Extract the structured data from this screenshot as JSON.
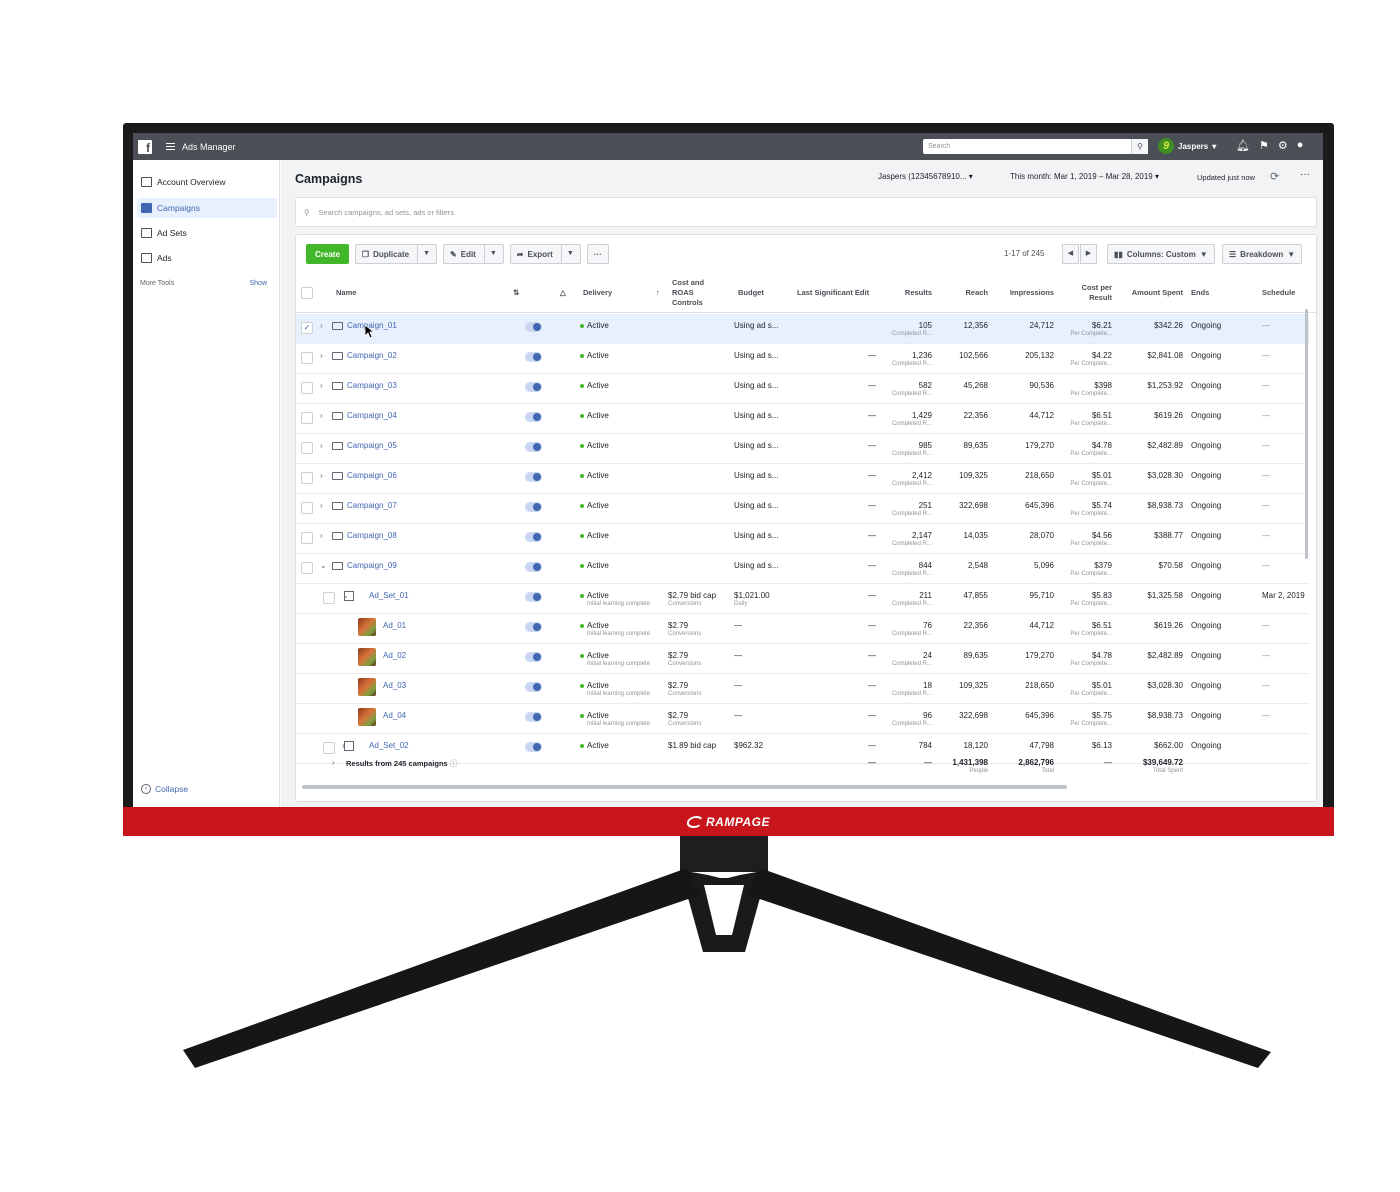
{
  "brand": {
    "name": "RAMPAGE"
  },
  "topbar": {
    "app_title": "Ads Manager",
    "search_placeholder": "Search",
    "user_name": "Jaspers",
    "avatar_letter": "9"
  },
  "sidebar": {
    "items": [
      {
        "label": "Account Overview",
        "icon": "account-overview-icon",
        "active": false
      },
      {
        "label": "Campaigns",
        "icon": "folder-icon",
        "active": true
      },
      {
        "label": "Ad Sets",
        "icon": "grid-icon",
        "active": false
      },
      {
        "label": "Ads",
        "icon": "ad-icon",
        "active": false
      }
    ],
    "more_tools": "More Tools",
    "show": "Show",
    "collapse": "Collapse"
  },
  "header": {
    "title": "Campaigns",
    "account": "Jaspers (12345678910...",
    "date_range": "This month: Mar 1, 2019 – Mar 28, 2019",
    "updated": "Updated just now"
  },
  "filter": {
    "placeholder": "Search campaigns, ad sets, ads or filters"
  },
  "toolbar": {
    "create": "Create",
    "duplicate": "Duplicate",
    "edit": "Edit",
    "export": "Export",
    "more": "···",
    "pager": "1-17 of 245",
    "columns": "Columns: Custom",
    "breakdown": "Breakdown"
  },
  "columns": {
    "name": "Name",
    "delivery": "Delivery",
    "cost_roas": [
      "Cost and",
      "ROAS",
      "Controls"
    ],
    "budget": "Budget",
    "last_edit": "Last Significant Edit",
    "results": "Results",
    "reach": "Reach",
    "impressions": "Impressions",
    "cost_per_result": [
      "Cost per",
      "Result"
    ],
    "amount_spent": "Amount Spent",
    "ends": "Ends",
    "schedule": "Schedule"
  },
  "rows": [
    {
      "type": "campaign",
      "name": "Campaign_01",
      "delivery": "Active",
      "delivery_sub": "",
      "cost": "",
      "cost_sub": "",
      "budget": "Using ad s...",
      "budget_sub": "",
      "last_edit": "",
      "results": "105",
      "results_sub": "Completed R...",
      "reach": "12,356",
      "impressions": "24,712",
      "cpr": "$6.21",
      "cpr_sub": "Per Complete...",
      "spent": "$342.26",
      "ends": "Ongoing",
      "schedule": "—",
      "selected": true,
      "expanded": false
    },
    {
      "type": "campaign",
      "name": "Campaign_02",
      "delivery": "Active",
      "delivery_sub": "",
      "cost": "",
      "cost_sub": "",
      "budget": "Using ad s...",
      "budget_sub": "",
      "last_edit": "—",
      "results": "1,236",
      "results_sub": "Completed R...",
      "reach": "102,566",
      "impressions": "205,132",
      "cpr": "$4.22",
      "cpr_sub": "Per Complete...",
      "spent": "$2,841.08",
      "ends": "Ongoing",
      "schedule": "—",
      "selected": false,
      "expanded": false
    },
    {
      "type": "campaign",
      "name": "Campaign_03",
      "delivery": "Active",
      "delivery_sub": "",
      "cost": "",
      "cost_sub": "",
      "budget": "Using ad s...",
      "budget_sub": "",
      "last_edit": "—",
      "results": "582",
      "results_sub": "Completed R...",
      "reach": "45,268",
      "impressions": "90,536",
      "cpr": "$398",
      "cpr_sub": "Per Complete...",
      "spent": "$1,253.92",
      "ends": "Ongoing",
      "schedule": "—",
      "selected": false,
      "expanded": false
    },
    {
      "type": "campaign",
      "name": "Campaign_04",
      "delivery": "Active",
      "delivery_sub": "",
      "cost": "",
      "cost_sub": "",
      "budget": "Using ad s...",
      "budget_sub": "",
      "last_edit": "—",
      "results": "1,429",
      "results_sub": "Completed R...",
      "reach": "22,356",
      "impressions": "44,712",
      "cpr": "$6.51",
      "cpr_sub": "Per Complete...",
      "spent": "$619.26",
      "ends": "Ongoing",
      "schedule": "—",
      "selected": false,
      "expanded": false
    },
    {
      "type": "campaign",
      "name": "Campaign_05",
      "delivery": "Active",
      "delivery_sub": "",
      "cost": "",
      "cost_sub": "",
      "budget": "Using ad s...",
      "budget_sub": "",
      "last_edit": "—",
      "results": "985",
      "results_sub": "Completed R...",
      "reach": "89,635",
      "impressions": "179,270",
      "cpr": "$4.78",
      "cpr_sub": "Per Complete...",
      "spent": "$2,482.89",
      "ends": "Ongoing",
      "schedule": "—",
      "selected": false,
      "expanded": false
    },
    {
      "type": "campaign",
      "name": "Campaign_06",
      "delivery": "Active",
      "delivery_sub": "",
      "cost": "",
      "cost_sub": "",
      "budget": "Using ad s...",
      "budget_sub": "",
      "last_edit": "—",
      "results": "2,412",
      "results_sub": "Completed R...",
      "reach": "109,325",
      "impressions": "218,650",
      "cpr": "$5.01",
      "cpr_sub": "Per Complete...",
      "spent": "$3,028.30",
      "ends": "Ongoing",
      "schedule": "—",
      "selected": false,
      "expanded": false
    },
    {
      "type": "campaign",
      "name": "Campaign_07",
      "delivery": "Active",
      "delivery_sub": "",
      "cost": "",
      "cost_sub": "",
      "budget": "Using ad s...",
      "budget_sub": "",
      "last_edit": "—",
      "results": "251",
      "results_sub": "Completed R...",
      "reach": "322,698",
      "impressions": "645,396",
      "cpr": "$5.74",
      "cpr_sub": "Per Complete...",
      "spent": "$8,938.73",
      "ends": "Ongoing",
      "schedule": "—",
      "selected": false,
      "expanded": false
    },
    {
      "type": "campaign",
      "name": "Campaign_08",
      "delivery": "Active",
      "delivery_sub": "",
      "cost": "",
      "cost_sub": "",
      "budget": "Using ad s...",
      "budget_sub": "",
      "last_edit": "—",
      "results": "2,147",
      "results_sub": "Completed R...",
      "reach": "14,035",
      "impressions": "28,070",
      "cpr": "$4.56",
      "cpr_sub": "Per Complete...",
      "spent": "$388.77",
      "ends": "Ongoing",
      "schedule": "—",
      "selected": false,
      "expanded": false
    },
    {
      "type": "campaign",
      "name": "Campaign_09",
      "delivery": "Active",
      "delivery_sub": "",
      "cost": "",
      "cost_sub": "",
      "budget": "Using ad s...",
      "budget_sub": "",
      "last_edit": "—",
      "results": "844",
      "results_sub": "Completed R...",
      "reach": "2,548",
      "impressions": "5,096",
      "cpr": "$379",
      "cpr_sub": "Per Complete...",
      "spent": "$70.58",
      "ends": "Ongoing",
      "schedule": "—",
      "selected": false,
      "expanded": true
    },
    {
      "type": "adset",
      "name": "Ad_Set_01",
      "delivery": "Active",
      "delivery_sub": "Initial learning complete",
      "cost": "$2.79 bid cap",
      "cost_sub": "Conversions",
      "budget": "$1,021.00",
      "budget_sub": "Daily",
      "last_edit": "—",
      "results": "211",
      "results_sub": "Completed R...",
      "reach": "47,855",
      "impressions": "95,710",
      "cpr": "$5.83",
      "cpr_sub": "Per Complete...",
      "spent": "$1,325.58",
      "ends": "Ongoing",
      "schedule": "Mar 2, 2019",
      "selected": false,
      "expanded": true
    },
    {
      "type": "ad",
      "name": "Ad_01",
      "delivery": "Active",
      "delivery_sub": "Initial learning complete",
      "cost": "$2.79",
      "cost_sub": "Conversions",
      "budget": "—",
      "budget_sub": "",
      "last_edit": "—",
      "results": "76",
      "results_sub": "Completed R...",
      "reach": "22,356",
      "impressions": "44,712",
      "cpr": "$6.51",
      "cpr_sub": "Per Complete...",
      "spent": "$619.26",
      "ends": "Ongoing",
      "schedule": "—",
      "selected": false,
      "expanded": false
    },
    {
      "type": "ad",
      "name": "Ad_02",
      "delivery": "Active",
      "delivery_sub": "Initial learning complete",
      "cost": "$2.79",
      "cost_sub": "Conversions",
      "budget": "—",
      "budget_sub": "",
      "last_edit": "—",
      "results": "24",
      "results_sub": "Completed R...",
      "reach": "89,635",
      "impressions": "179,270",
      "cpr": "$4.78",
      "cpr_sub": "Per Complete...",
      "spent": "$2,482.89",
      "ends": "Ongoing",
      "schedule": "—",
      "selected": false,
      "expanded": false
    },
    {
      "type": "ad",
      "name": "Ad_03",
      "delivery": "Active",
      "delivery_sub": "Initial learning complete",
      "cost": "$2.79",
      "cost_sub": "Conversions",
      "budget": "—",
      "budget_sub": "",
      "last_edit": "—",
      "results": "18",
      "results_sub": "Completed R...",
      "reach": "109,325",
      "impressions": "218,650",
      "cpr": "$5.01",
      "cpr_sub": "Per Complete...",
      "spent": "$3,028.30",
      "ends": "Ongoing",
      "schedule": "—",
      "selected": false,
      "expanded": false
    },
    {
      "type": "ad",
      "name": "Ad_04",
      "delivery": "Active",
      "delivery_sub": "Initial learning complete",
      "cost": "$2.79",
      "cost_sub": "Conversions",
      "budget": "—",
      "budget_sub": "",
      "last_edit": "—",
      "results": "96",
      "results_sub": "Completed R...",
      "reach": "322,698",
      "impressions": "645,396",
      "cpr": "$5.75",
      "cpr_sub": "Per Complete...",
      "spent": "$8,938.73",
      "ends": "Ongoing",
      "schedule": "—",
      "selected": false,
      "expanded": false
    },
    {
      "type": "adset",
      "name": "Ad_Set_02",
      "delivery": "Active",
      "delivery_sub": "",
      "cost": "$1.89 bid cap",
      "cost_sub": "",
      "budget": "$962.32",
      "budget_sub": "",
      "last_edit": "—",
      "results": "784",
      "results_sub": "",
      "reach": "18,120",
      "impressions": "47,798",
      "cpr": "$6.13",
      "cpr_sub": "",
      "spent": "$662.00",
      "ends": "Ongoing",
      "schedule": "",
      "selected": false,
      "expanded": false
    }
  ],
  "totals": {
    "label": "Results from 245 campaigns",
    "last_edit": "—",
    "results": "—",
    "reach": "1,431,398",
    "reach_sub": "People",
    "impressions": "2,862,796",
    "impressions_sub": "Total",
    "cpr": "—",
    "spent": "$39,649.72",
    "spent_sub": "Total Spent"
  },
  "colors": {
    "accent": "#4267b2",
    "create": "#42b72a",
    "topbar": "#4b4f56",
    "bezel_red": "#c8141b"
  }
}
